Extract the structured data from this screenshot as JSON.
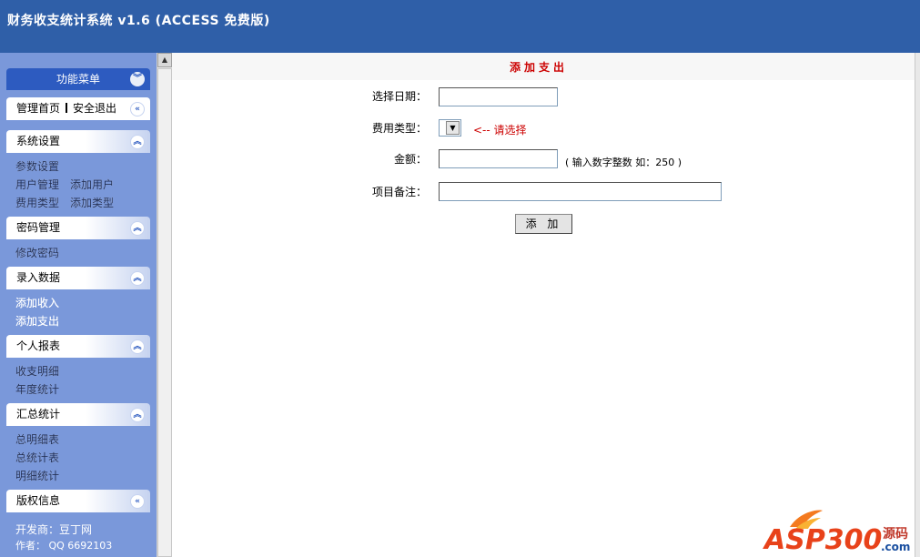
{
  "header": {
    "title": "财务收支统计系统 v1.6 (ACCESS 免费版)"
  },
  "sidebar": {
    "menu_title": "功能菜单",
    "home": "管理首页",
    "logout": "安全退出",
    "sections": [
      {
        "title": "系统设置",
        "items": [
          "参数设置",
          "用户管理",
          "添加用户",
          "费用类型",
          "添加类型"
        ]
      },
      {
        "title": "密码管理",
        "items": [
          "修改密码"
        ]
      },
      {
        "title": "录入数据",
        "items": [
          "添加收入",
          "添加支出"
        ]
      },
      {
        "title": "个人报表",
        "items": [
          "收支明细",
          "年度统计"
        ]
      },
      {
        "title": "汇总统计",
        "items": [
          "总明细表",
          "总统计表",
          "明细统计"
        ]
      },
      {
        "title": "版权信息",
        "items": []
      }
    ],
    "credits": {
      "developer": "开发商：豆丁网",
      "author": "作者： QQ 6692103"
    }
  },
  "form": {
    "title": "添加支出",
    "date_label": "选择日期：",
    "date_value": "",
    "type_label": "费用类型：",
    "type_value": "",
    "type_hint": "<-- 请选择",
    "amount_label": "金额：",
    "amount_value": "",
    "amount_hint": "( 输入数字整数  如：250 )",
    "note_label": "项目备注：",
    "note_value": "",
    "submit_label": "添 加"
  },
  "watermark": {
    "brand": "ASP300",
    "suffix": "源码",
    "domain": ".com"
  },
  "colors": {
    "header_bg": "#2f5fa8",
    "sidebar_bg": "#7a98da",
    "accent_red": "#cc0000"
  }
}
